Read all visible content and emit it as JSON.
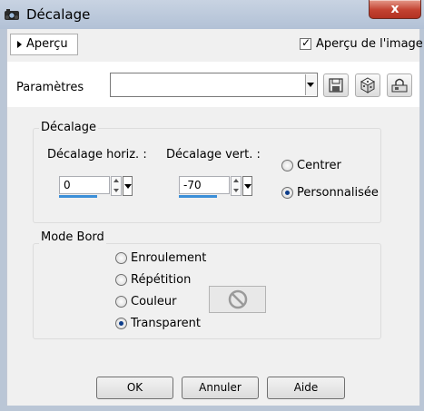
{
  "window": {
    "title": "Décalage",
    "close_glyph": "x"
  },
  "preview": {
    "toggle_label": "Aperçu",
    "image_preview_label": "Aperçu de l'image",
    "image_preview_checked": true
  },
  "params": {
    "label": "Paramètres",
    "preset_value": "",
    "tools": [
      "save-preset-icon",
      "randomize-dice-icon",
      "preset-options-icon"
    ]
  },
  "offset": {
    "group_title": "Décalage",
    "horizontal": {
      "label": "Décalage horiz. :",
      "value": "0"
    },
    "vertical": {
      "label": "Décalage vert. :",
      "value": "-70"
    },
    "center_label": "Centrer",
    "custom_label": "Personnalisée",
    "selected": "custom"
  },
  "edge": {
    "group_title": "Mode Bord",
    "options": [
      "Enroulement",
      "Répétition",
      "Couleur",
      "Transparent"
    ],
    "selected": "Transparent"
  },
  "buttons": {
    "ok": "OK",
    "cancel": "Annuler",
    "help": "Aide"
  },
  "colors": {
    "accent": "#3c8fd8",
    "radio_selected": "#0c3c8a",
    "close_red": "#c34231"
  }
}
